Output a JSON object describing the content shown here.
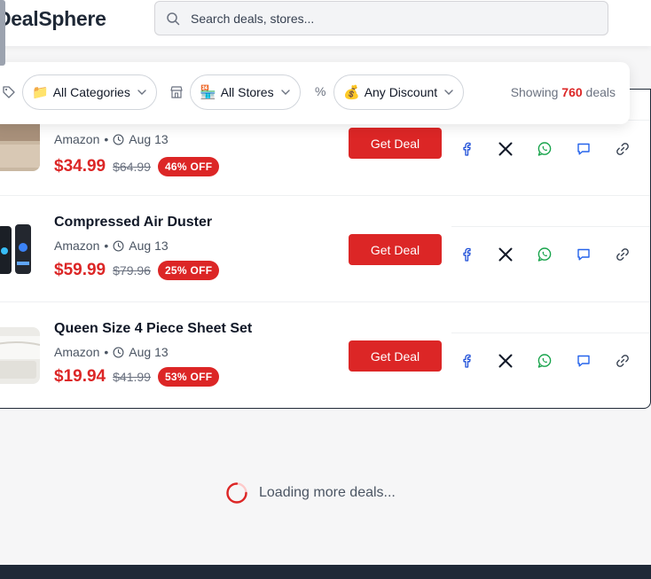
{
  "header": {
    "logo_text": "DealSphere",
    "search_placeholder": "Search deals, stores..."
  },
  "filters": {
    "category_label": "All Categories",
    "category_emoji": "📁",
    "store_label": "All Stores",
    "store_emoji": "🏪",
    "discount_label": "Any Discount",
    "discount_emoji": "💰",
    "discount_symbol": "%",
    "showing_prefix": "Showing",
    "showing_count": "760",
    "showing_suffix": "deals"
  },
  "deals": [
    {
      "title": "",
      "store": "Amazon",
      "date": "Aug 13",
      "price": "$34.99",
      "old_price": "$64.99",
      "discount": "46% OFF",
      "button": "Get Deal"
    },
    {
      "title": "Compressed Air Duster",
      "store": "Amazon",
      "date": "Aug 13",
      "price": "$59.99",
      "old_price": "$79.96",
      "discount": "25% OFF",
      "button": "Get Deal"
    },
    {
      "title": "Queen Size 4 Piece Sheet Set",
      "store": "Amazon",
      "date": "Aug 13",
      "price": "$19.94",
      "old_price": "$41.99",
      "discount": "53% OFF",
      "button": "Get Deal"
    }
  ],
  "meta_separator": "•",
  "loading_text": "Loading more deals...",
  "colors": {
    "accent": "#dc2626",
    "facebook": "#1d4ed8",
    "whatsapp": "#16a34a",
    "comment": "#2563eb",
    "footer": "#1f2937"
  },
  "icons": {
    "share": [
      "facebook-icon",
      "x-icon",
      "whatsapp-icon",
      "comment-icon",
      "link-icon"
    ]
  }
}
